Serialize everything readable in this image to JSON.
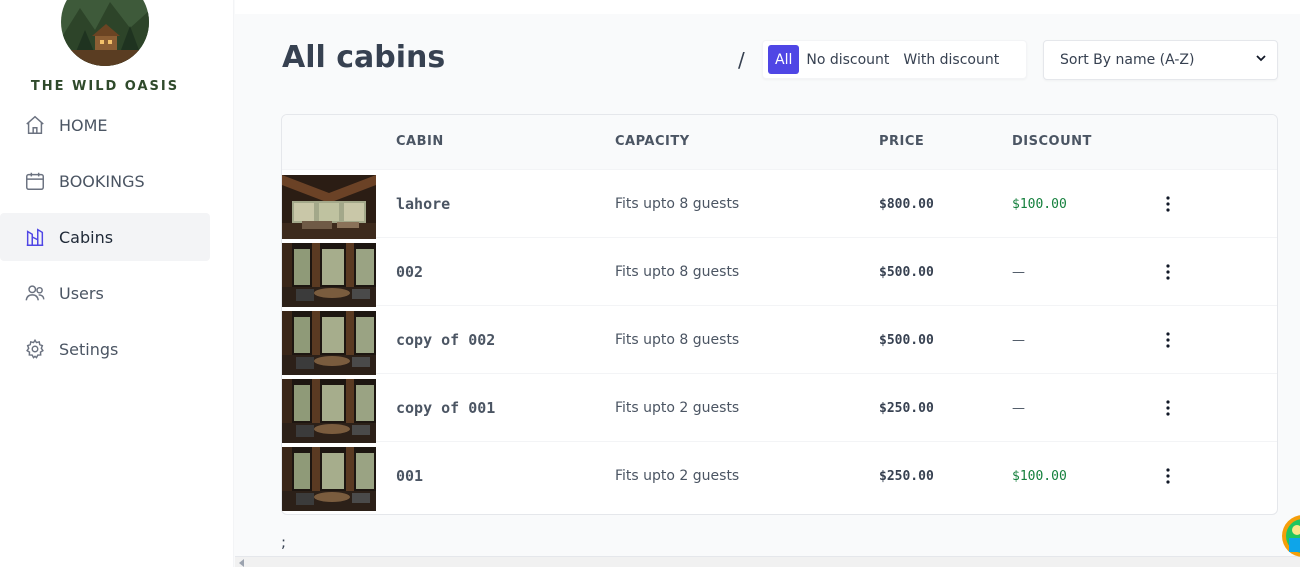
{
  "brand": {
    "name": "THE WILD OASIS",
    "logo_icon": "mountain-cabin-logo"
  },
  "sidebar": {
    "items": [
      {
        "label": "HOME",
        "icon": "home-icon",
        "active": false
      },
      {
        "label": "BOOKINGS",
        "icon": "calendar-icon",
        "active": false
      },
      {
        "label": "Cabins",
        "icon": "cabins-icon",
        "active": true
      },
      {
        "label": "Users",
        "icon": "users-icon",
        "active": false
      },
      {
        "label": "Setings",
        "icon": "gear-icon",
        "active": false
      }
    ]
  },
  "header": {
    "title": "All cabins",
    "separator": "/",
    "filter": {
      "options": [
        "All",
        "No discount",
        "With discount"
      ],
      "selected": "All"
    },
    "sort": {
      "selected": "Sort By name (A-Z)"
    }
  },
  "table": {
    "columns": [
      "CABIN",
      "CAPACITY",
      "PRICE",
      "DISCOUNT"
    ],
    "rows": [
      {
        "name": "lahore",
        "capacity": "Fits upto 8 guests",
        "price": "$800.00",
        "discount": "$100.00"
      },
      {
        "name": "002",
        "capacity": "Fits upto 8 guests",
        "price": "$500.00",
        "discount": "—"
      },
      {
        "name": "copy of 002",
        "capacity": "Fits upto 8 guests",
        "price": "$500.00",
        "discount": "—"
      },
      {
        "name": "copy of 001",
        "capacity": "Fits upto 2 guests",
        "price": "$250.00",
        "discount": "—"
      },
      {
        "name": "001",
        "capacity": "Fits upto 2 guests",
        "price": "$250.00",
        "discount": "$100.00"
      }
    ]
  },
  "footer_text": ";",
  "colors": {
    "accent": "#4f46e5",
    "discount": "#15803d",
    "brand": "#2f4a2b"
  }
}
